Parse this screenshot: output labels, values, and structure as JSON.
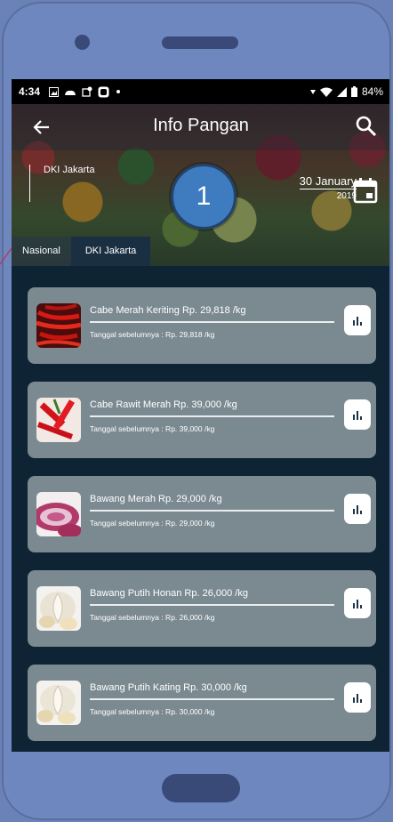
{
  "status_bar": {
    "time": "4:34",
    "battery": "84%",
    "left_icons": [
      "image-icon",
      "weather-icon",
      "notification-icon",
      "app-icon",
      "dot-icon"
    ],
    "right_icons": [
      "network-icon",
      "wifi-icon",
      "signal-icon",
      "battery-icon"
    ]
  },
  "app_bar": {
    "title": "Info Pangan",
    "back_icon": "arrow-left-icon",
    "search_icon": "search-icon"
  },
  "header": {
    "region": "DKI Jakarta",
    "date_day_month": "30 January",
    "date_year": "2019",
    "calendar_icon": "calendar-icon",
    "badge_number": "1"
  },
  "tabs": [
    {
      "label": "Nasional",
      "active": false
    },
    {
      "label": "DKI Jakarta",
      "active": true
    }
  ],
  "items": [
    {
      "title": "Cabe Merah Keriting Rp. 29,818 /kg",
      "previous": "Tanggal sebelumnya : Rp. 29,818 /kg",
      "image": "red-chili"
    },
    {
      "title": "Cabe Rawit Merah Rp. 39,000 /kg",
      "previous": "Tanggal sebelumnya : Rp. 39,000 /kg",
      "image": "bird-eye-chili"
    },
    {
      "title": "Bawang Merah Rp. 29,000 /kg",
      "previous": "Tanggal sebelumnya : Rp. 29,000 /kg",
      "image": "shallot"
    },
    {
      "title": "Bawang Putih Honan Rp. 26,000 /kg",
      "previous": "Tanggal sebelumnya : Rp. 26,000 /kg",
      "image": "garlic"
    },
    {
      "title": "Bawang Putih Kating Rp. 30,000 /kg",
      "previous": "Tanggal sebelumnya : Rp. 30,000 /kg",
      "image": "garlic"
    }
  ],
  "colors": {
    "phone_body": "#6e87bf",
    "screen_bg": "#0e2333",
    "card_bg": "#7b8a91",
    "badge": "#3e7bbf",
    "active_tab": "#1b2f42"
  }
}
